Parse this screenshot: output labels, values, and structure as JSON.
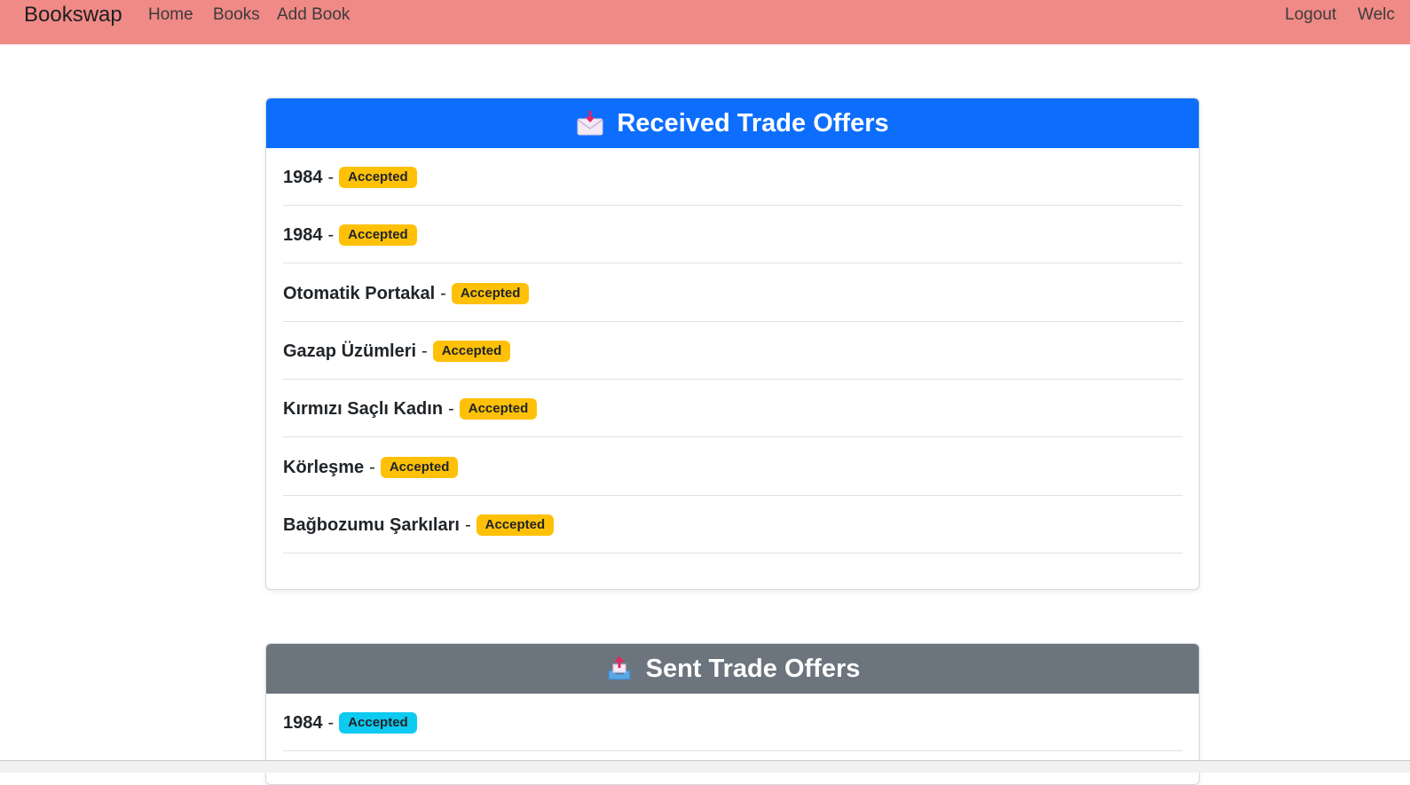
{
  "nav": {
    "brand": "Bookswap",
    "links": [
      "Home",
      "Books",
      "Add Book"
    ],
    "right": [
      "Logout",
      "Welc"
    ]
  },
  "received": {
    "title": "Received Trade Offers",
    "header_color": "#0d6efd",
    "icon": "incoming-envelope-icon",
    "items": [
      {
        "title": "1984",
        "status": "Accepted"
      },
      {
        "title": "1984",
        "status": "Accepted"
      },
      {
        "title": "Otomatik Portakal",
        "status": "Accepted"
      },
      {
        "title": "Gazap Üzümleri",
        "status": "Accepted"
      },
      {
        "title": "Kırmızı Saçlı Kadın",
        "status": "Accepted"
      },
      {
        "title": "Körleşme",
        "status": "Accepted"
      },
      {
        "title": "Bağbozumu Şarkıları",
        "status": "Accepted"
      }
    ]
  },
  "sent": {
    "title": "Sent Trade Offers",
    "header_color": "#6c757d",
    "icon": "outbox-tray-icon",
    "items": [
      {
        "title": "1984",
        "status": "Accepted"
      }
    ]
  },
  "colors": {
    "navbar": "#f08a87",
    "badge_received": "#ffc107",
    "badge_sent": "#0dcaf0"
  }
}
